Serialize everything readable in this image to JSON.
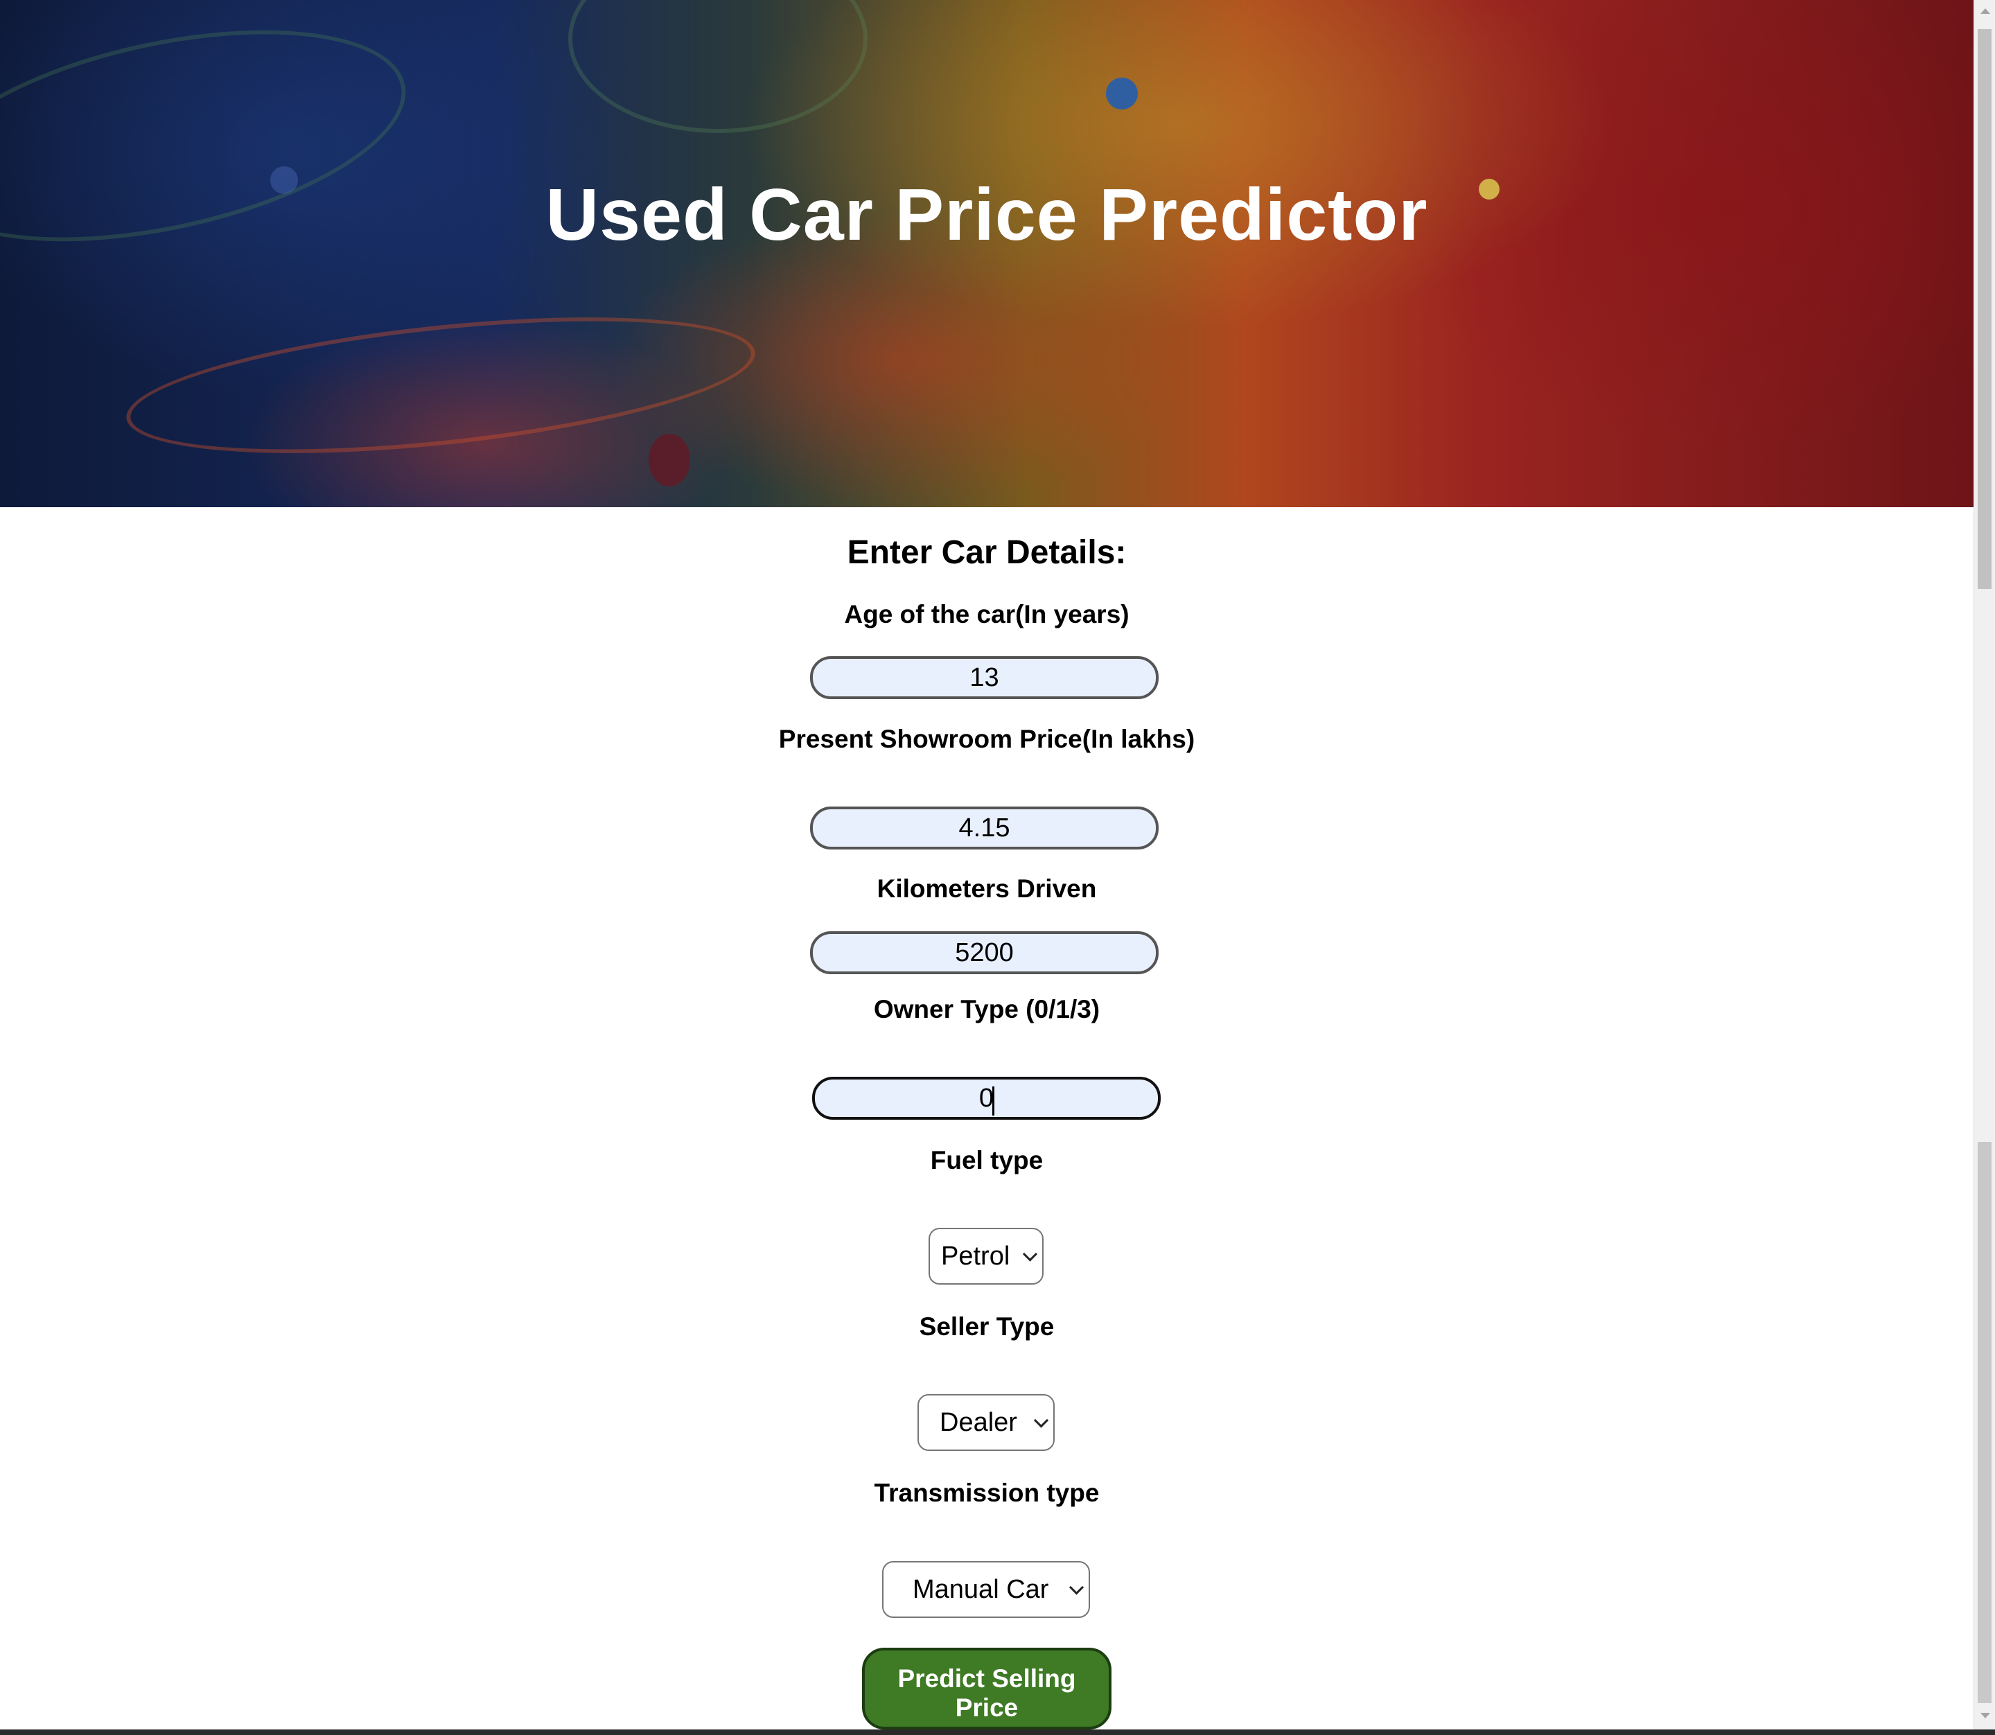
{
  "header": {
    "title": "Used Car Price Predictor"
  },
  "form": {
    "heading": "Enter Car Details:",
    "age": {
      "label": "Age of the car(In years)",
      "value": "13"
    },
    "showroom_price": {
      "label": "Present Showroom Price(In lakhs)",
      "value": "4.15"
    },
    "kms_driven": {
      "label": "Kilometers Driven",
      "value": "5200"
    },
    "owner_type": {
      "label": "Owner Type (0/1/3)",
      "value": "0"
    },
    "fuel_type": {
      "label": "Fuel type",
      "selected": "Petrol"
    },
    "seller_type": {
      "label": "Seller Type",
      "selected": "Dealer"
    },
    "transmission_type": {
      "label": "Transmission type",
      "selected": "Manual Car"
    },
    "submit": {
      "label_line1": "Predict Selling",
      "label_line2": "Price"
    }
  },
  "colors": {
    "button_bg": "#3f7a24",
    "input_bg": "#e8f0fe"
  },
  "icons": {
    "select_arrow": "chevron-down-icon"
  }
}
